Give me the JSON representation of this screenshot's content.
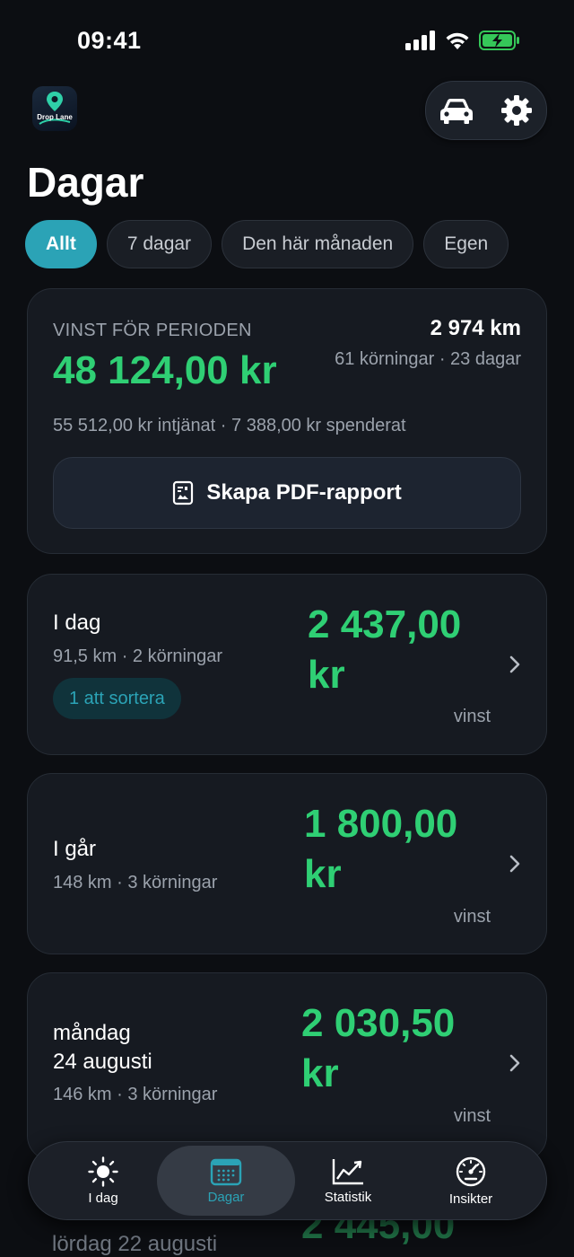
{
  "status_bar": {
    "time": "09:41"
  },
  "app": {
    "logo_text": "Drop Lane"
  },
  "page": {
    "title": "Dagar"
  },
  "filters": [
    {
      "label": "Allt",
      "active": true
    },
    {
      "label": "7 dagar",
      "active": false
    },
    {
      "label": "Den här månaden",
      "active": false
    },
    {
      "label": "Egen",
      "active": false
    }
  ],
  "summary": {
    "label": "VINST FÖR PERIODEN",
    "profit": "48 124,00 kr",
    "distance": "2 974 km",
    "trips_days": "61 körningar · 23 dagar",
    "earned_spent": "55 512,00 kr intjänat · 7 388,00 kr spenderat",
    "pdf_button": "Skapa PDF-rapport"
  },
  "days": [
    {
      "title": "I dag",
      "sub": "91,5 km · 2 körningar",
      "badge": "1 att sortera",
      "amount_line1": "2 437,00",
      "amount_line2": "kr",
      "profit_label": "vinst"
    },
    {
      "title": "I går",
      "sub": "148 km · 3 körningar",
      "amount_line1": "1 800,00",
      "amount_line2": "kr",
      "profit_label": "vinst"
    },
    {
      "title_line1": "måndag",
      "title_line2": "24 augusti",
      "sub": "146 km · 3 körningar",
      "amount_line1": "2 030,50",
      "amount_line2": "kr",
      "profit_label": "vinst"
    }
  ],
  "peek": {
    "title": "lördag 22 augusti",
    "amount": "2 445,00"
  },
  "tabs": [
    {
      "label": "I dag",
      "icon": "sun-icon",
      "active": false
    },
    {
      "label": "Dagar",
      "icon": "calendar-icon",
      "active": true
    },
    {
      "label": "Statistik",
      "icon": "chart-icon",
      "active": false
    },
    {
      "label": "Insikter",
      "icon": "gauge-icon",
      "active": false
    }
  ],
  "colors": {
    "accent": "#2ba3b6",
    "profit": "#2fcf74",
    "background": "#0c0e12",
    "card": "#161a21"
  }
}
